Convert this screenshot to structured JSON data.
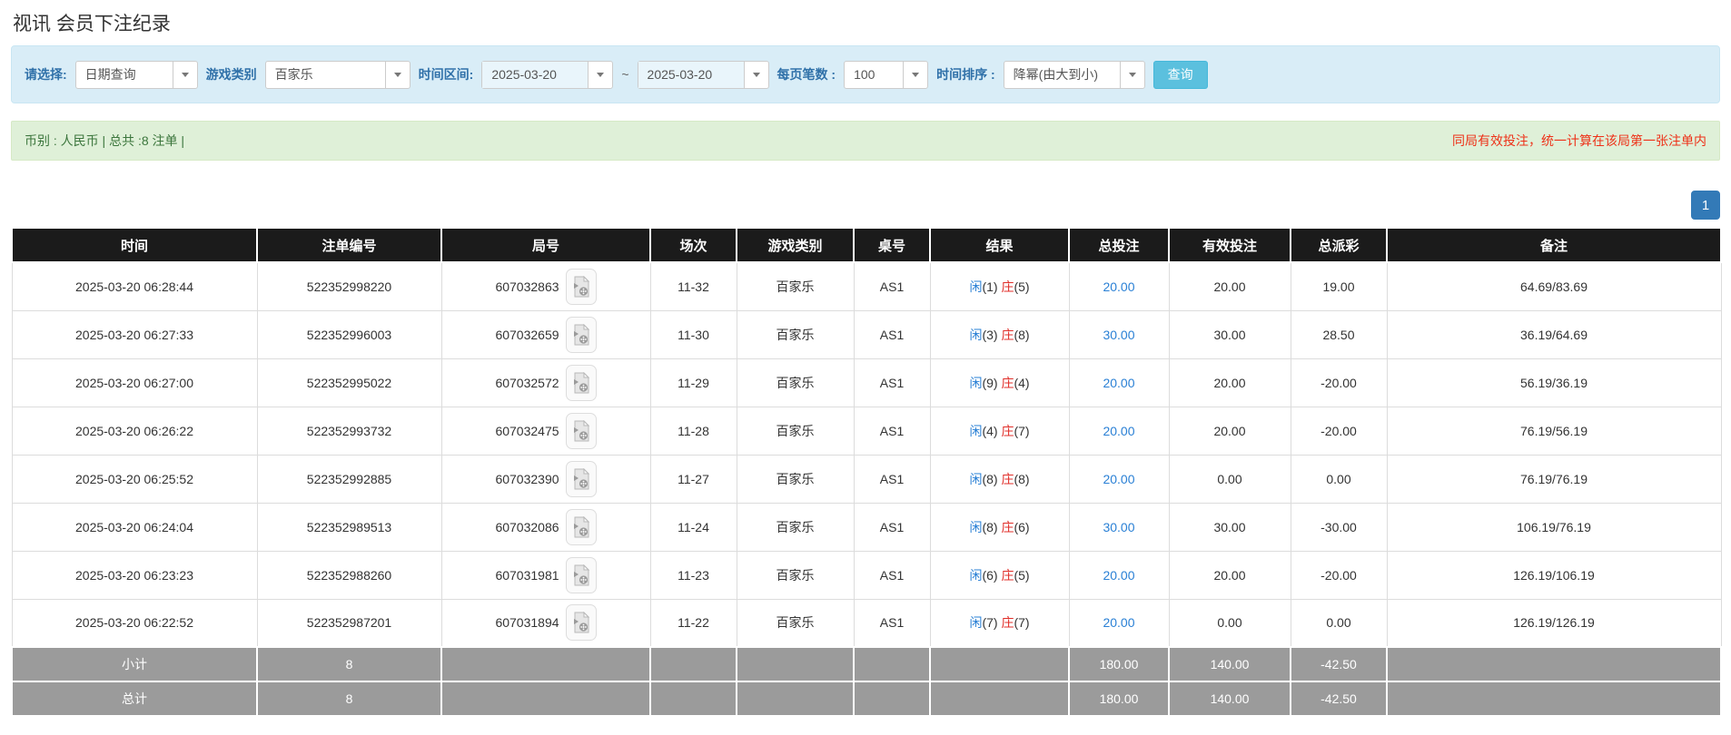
{
  "page": {
    "title": "视讯 会员下注纪录"
  },
  "colors": {
    "header_bg": "#1b1b1b",
    "accent_label": "#3071a9",
    "filter_bar_bg": "#d9edf7",
    "button_bg": "#5bc0de",
    "alert_bg": "#dff0d8",
    "alert_text": "#3c763d",
    "warning_red": "#ee3118",
    "link_blue": "#2a80d5",
    "player_blue": "#2a80d5",
    "banker_red": "#e02d28",
    "negative_red": "#ff0000",
    "summary_bg": "#9b9b9b",
    "pagination_bg": "#337ab7"
  },
  "filters": {
    "mode_label": "请选择:",
    "mode_value": "日期查询",
    "game_type_label": "游戏类别",
    "game_type_value": "百家乐",
    "date_range_label": "时间区间:",
    "date_from": "2025-03-20",
    "date_separator": "~",
    "date_to": "2025-03-20",
    "page_size_label": "每页笔数 :",
    "page_size_value": "100",
    "sort_label": "时间排序 :",
    "sort_value": "降幂(由大到小)",
    "search_button": "查询"
  },
  "summary_bar": {
    "left_text": "币别 : 人民币 | 总共 :8 注单 |",
    "right_text": "同局有效投注，统一计算在该局第一张注单内"
  },
  "pagination": {
    "current": "1"
  },
  "table": {
    "headers": [
      "时间",
      "注单编号",
      "局号",
      "场次",
      "游戏类别",
      "桌号",
      "结果",
      "总投注",
      "有效投注",
      "总派彩",
      "备注"
    ],
    "rows": [
      {
        "time": "2025-03-20 06:28:44",
        "bet_id": "522352998220",
        "round_id": "607032863",
        "session": "11-32",
        "game": "百家乐",
        "table_no": "AS1",
        "result": {
          "p_label": "闲",
          "p_num": "(1)",
          "b_label": "庄",
          "b_num": "(5)"
        },
        "total_bet": "20.00",
        "valid_bet": "20.00",
        "payout": "19.00",
        "remark": "64.69/83.69"
      },
      {
        "time": "2025-03-20 06:27:33",
        "bet_id": "522352996003",
        "round_id": "607032659",
        "session": "11-30",
        "game": "百家乐",
        "table_no": "AS1",
        "result": {
          "p_label": "闲",
          "p_num": "(3)",
          "b_label": "庄",
          "b_num": "(8)"
        },
        "total_bet": "30.00",
        "valid_bet": "30.00",
        "payout": "28.50",
        "remark": "36.19/64.69"
      },
      {
        "time": "2025-03-20 06:27:00",
        "bet_id": "522352995022",
        "round_id": "607032572",
        "session": "11-29",
        "game": "百家乐",
        "table_no": "AS1",
        "result": {
          "p_label": "闲",
          "p_num": "(9)",
          "b_label": "庄",
          "b_num": "(4)"
        },
        "total_bet": "20.00",
        "valid_bet": "20.00",
        "payout": "-20.00",
        "remark": "56.19/36.19"
      },
      {
        "time": "2025-03-20 06:26:22",
        "bet_id": "522352993732",
        "round_id": "607032475",
        "session": "11-28",
        "game": "百家乐",
        "table_no": "AS1",
        "result": {
          "p_label": "闲",
          "p_num": "(4)",
          "b_label": "庄",
          "b_num": "(7)"
        },
        "total_bet": "20.00",
        "valid_bet": "20.00",
        "payout": "-20.00",
        "remark": "76.19/56.19"
      },
      {
        "time": "2025-03-20 06:25:52",
        "bet_id": "522352992885",
        "round_id": "607032390",
        "session": "11-27",
        "game": "百家乐",
        "table_no": "AS1",
        "result": {
          "p_label": "闲",
          "p_num": "(8)",
          "b_label": "庄",
          "b_num": "(8)"
        },
        "total_bet": "20.00",
        "valid_bet": "0.00",
        "payout": "0.00",
        "remark": "76.19/76.19"
      },
      {
        "time": "2025-03-20 06:24:04",
        "bet_id": "522352989513",
        "round_id": "607032086",
        "session": "11-24",
        "game": "百家乐",
        "table_no": "AS1",
        "result": {
          "p_label": "闲",
          "p_num": "(8)",
          "b_label": "庄",
          "b_num": "(6)"
        },
        "total_bet": "30.00",
        "valid_bet": "30.00",
        "payout": "-30.00",
        "remark": "106.19/76.19"
      },
      {
        "time": "2025-03-20 06:23:23",
        "bet_id": "522352988260",
        "round_id": "607031981",
        "session": "11-23",
        "game": "百家乐",
        "table_no": "AS1",
        "result": {
          "p_label": "闲",
          "p_num": "(6)",
          "b_label": "庄",
          "b_num": "(5)"
        },
        "total_bet": "20.00",
        "valid_bet": "20.00",
        "payout": "-20.00",
        "remark": "126.19/106.19"
      },
      {
        "time": "2025-03-20 06:22:52",
        "bet_id": "522352987201",
        "round_id": "607031894",
        "session": "11-22",
        "game": "百家乐",
        "table_no": "AS1",
        "result": {
          "p_label": "闲",
          "p_num": "(7)",
          "b_label": "庄",
          "b_num": "(7)"
        },
        "total_bet": "20.00",
        "valid_bet": "0.00",
        "payout": "0.00",
        "remark": "126.19/126.19"
      }
    ],
    "subtotal": {
      "label": "小计",
      "count": "8",
      "total_bet": "180.00",
      "valid_bet": "140.00",
      "payout": "-42.50"
    },
    "total": {
      "label": "总计",
      "count": "8",
      "total_bet": "180.00",
      "valid_bet": "140.00",
      "payout": "-42.50"
    }
  }
}
